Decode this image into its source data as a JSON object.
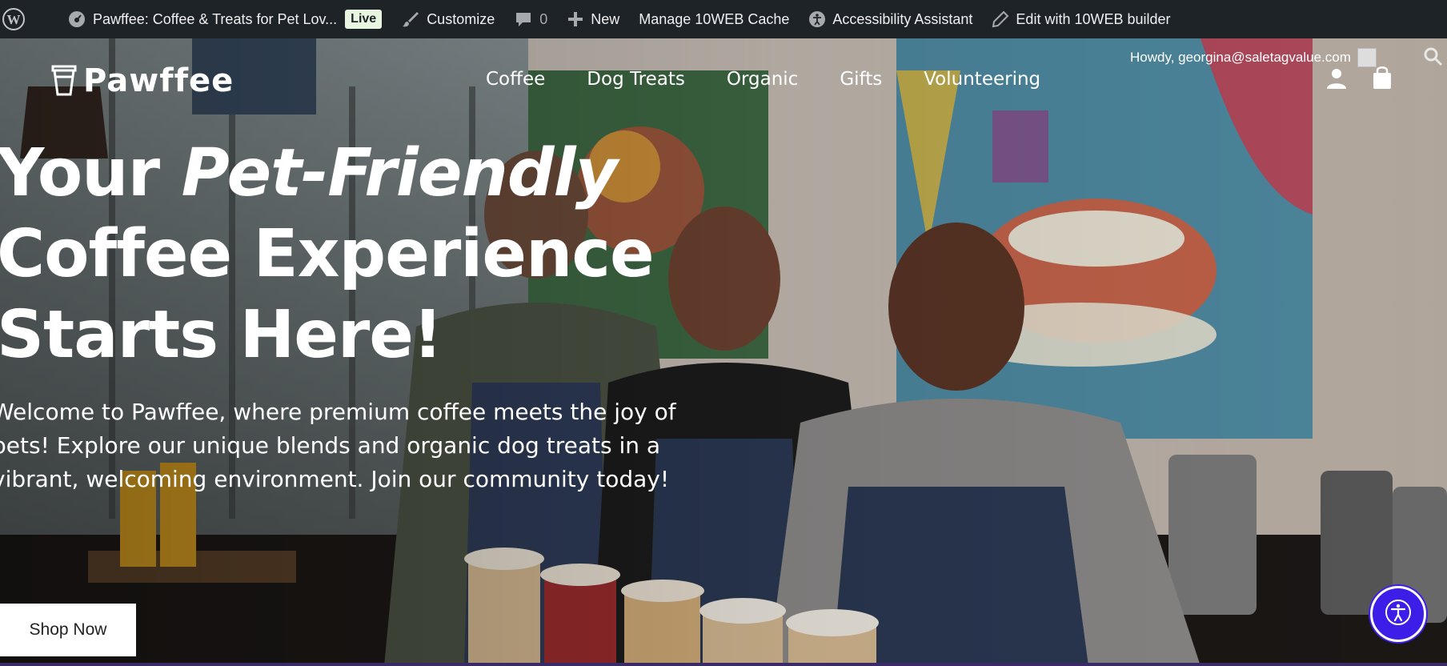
{
  "adminbar": {
    "site_title": "Pawffee: Coffee & Treats for Pet Lov...",
    "live_badge": "Live",
    "customize": "Customize",
    "comments_count": "0",
    "new": "New",
    "manage_cache": "Manage 10WEB Cache",
    "accessibility": "Accessibility Assistant",
    "edit_builder": "Edit with 10WEB builder",
    "icons": [
      "wordpress-icon",
      "dashboard-icon",
      "brush-icon",
      "comment-icon",
      "plus-icon",
      "accessibility-icon",
      "pencil-icon"
    ]
  },
  "header": {
    "logo_text": "Pawffee",
    "nav": [
      "Coffee",
      "Dog Treats",
      "Organic",
      "Gifts",
      "Volunteering"
    ],
    "howdy": "Howdy, georgina@saletagvalue.com"
  },
  "hero": {
    "headline_line1_a": "Your ",
    "headline_line1_b": "Pet-Friendly",
    "headline_line2": "Coffee Experience",
    "headline_line3": "Starts Here!",
    "subtext": "Welcome to Pawffee, where premium coffee meets the joy of pets! Explore our unique blends and organic dog treats in a vibrant, welcoming environment. Join our community today!",
    "cta": "Shop Now"
  },
  "colors": {
    "adminbar_bg": "#1d2327",
    "live_badge_bg": "#e7f5e1",
    "a11y_button": "#3d1de8"
  }
}
